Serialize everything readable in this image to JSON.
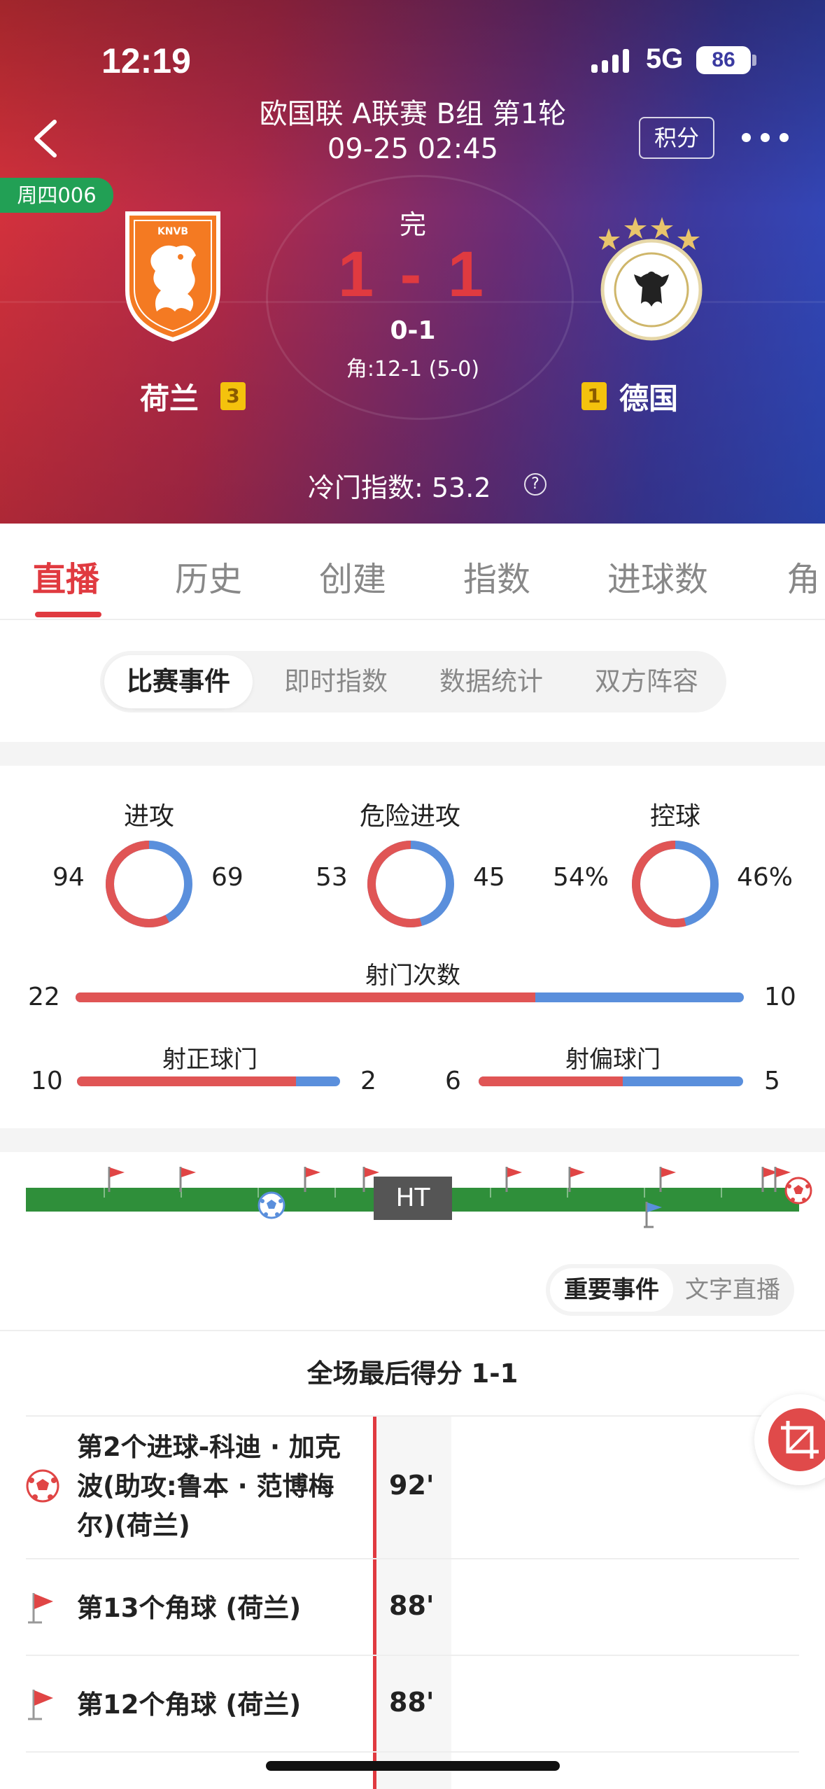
{
  "status_bar": {
    "time": "12:19",
    "network": "5G",
    "battery": "86"
  },
  "header": {
    "title_line1": "欧国联 A联赛 B组 第1轮",
    "title_line2": "09-25 02:45",
    "points_button": "积分",
    "lottery_badge": "周四006",
    "match_status": "完",
    "score": "1 - 1",
    "half_score": "0-1",
    "corner_score": "角:12-1 (5-0)",
    "home_team": {
      "name": "荷兰",
      "rank": "3"
    },
    "away_team": {
      "name": "德国",
      "rank": "1"
    },
    "upset_index": "冷门指数:  53.2",
    "help_glyph": "?"
  },
  "tabs": [
    "直播",
    "历史",
    "创建",
    "指数",
    "进球数",
    "角"
  ],
  "segments": [
    "比赛事件",
    "即时指数",
    "数据统计",
    "双方阵容"
  ],
  "stats": {
    "donuts": [
      {
        "title": "进攻",
        "home": "94",
        "away": "69",
        "home_value": 94,
        "away_value": 69
      },
      {
        "title": "危险进攻",
        "home": "53",
        "away": "45",
        "home_value": 53,
        "away_value": 45
      },
      {
        "title": "控球",
        "home": "54%",
        "away": "46%",
        "home_value": 54,
        "away_value": 46
      }
    ],
    "shots": {
      "label": "射门次数",
      "home": "22",
      "away": "10",
      "home_value": 22,
      "away_value": 10
    },
    "on_target": {
      "label": "射正球门",
      "home": "10",
      "away": "2",
      "home_value": 10,
      "away_value": 2
    },
    "off_target": {
      "label": "射偏球门",
      "home": "6",
      "away": "5",
      "home_value": 6,
      "away_value": 5
    }
  },
  "timeline": {
    "halftime_label": "HT"
  },
  "event_toggle": [
    "重要事件",
    "文字直播"
  ],
  "final_score_label": "全场最后得分 1-1",
  "events": [
    {
      "line1": "第2个进球-科迪 · 加克",
      "line2": "波(助攻:鲁本 · 范博梅",
      "line3": "尔)(荷兰)",
      "minute": "92'",
      "icon": "soccer-ball-icon"
    },
    {
      "line1": "第13个角球 (荷兰)",
      "minute": "88'",
      "icon": "corner-flag-icon"
    },
    {
      "line1": "第12个角球 (荷兰)",
      "minute": "88'",
      "icon": "corner-flag-icon"
    }
  ],
  "colors": {
    "home": "#e05555",
    "away": "#5a8fdc",
    "accent": "#e03a40",
    "pitch": "#2f8f3a"
  }
}
